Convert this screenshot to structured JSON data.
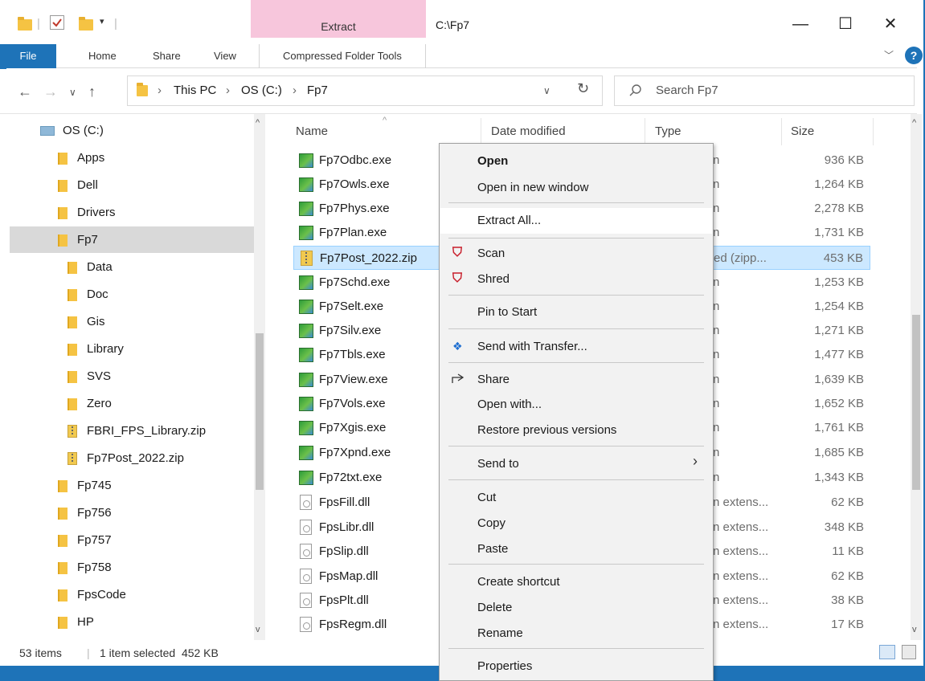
{
  "window": {
    "path": "C:\\Fp7",
    "context_tab": "Extract"
  },
  "titlebar": {
    "minimize": "—",
    "maximize": "☐",
    "close": "✕"
  },
  "ribbon": {
    "file": "File",
    "home": "Home",
    "share": "Share",
    "view": "View",
    "compressed": "Compressed Folder Tools",
    "help": "?"
  },
  "address": {
    "this_pc": "This PC",
    "drive": "OS (C:)",
    "folder": "Fp7"
  },
  "search": {
    "placeholder": "Search Fp7"
  },
  "tree": [
    {
      "label": "OS (C:)",
      "type": "drive"
    },
    {
      "label": "Apps",
      "type": "folder"
    },
    {
      "label": "Dell",
      "type": "folder"
    },
    {
      "label": "Drivers",
      "type": "folder"
    },
    {
      "label": "Fp7",
      "type": "folder",
      "selected": true
    },
    {
      "label": "Data",
      "type": "folder"
    },
    {
      "label": "Doc",
      "type": "folder"
    },
    {
      "label": "Gis",
      "type": "folder"
    },
    {
      "label": "Library",
      "type": "folder"
    },
    {
      "label": "SVS",
      "type": "folder"
    },
    {
      "label": "Zero",
      "type": "folder"
    },
    {
      "label": "FBRI_FPS_Library.zip",
      "type": "zip"
    },
    {
      "label": "Fp7Post_2022.zip",
      "type": "zip"
    },
    {
      "label": "Fp745",
      "type": "folder"
    },
    {
      "label": "Fp756",
      "type": "folder"
    },
    {
      "label": "Fp757",
      "type": "folder"
    },
    {
      "label": "Fp758",
      "type": "folder"
    },
    {
      "label": "FpsCode",
      "type": "folder"
    },
    {
      "label": "HP",
      "type": "folder"
    }
  ],
  "columns": {
    "name": "Name",
    "date": "Date modified",
    "type": "Type",
    "size": "Size"
  },
  "files": [
    {
      "name": "Fp7Odbc.exe",
      "type": "n",
      "size": "936 KB",
      "icon": "exe"
    },
    {
      "name": "Fp7Owls.exe",
      "type": "n",
      "size": "1,264 KB",
      "icon": "exe"
    },
    {
      "name": "Fp7Phys.exe",
      "type": "n",
      "size": "2,278 KB",
      "icon": "exe"
    },
    {
      "name": "Fp7Plan.exe",
      "type": "n",
      "size": "1,731 KB",
      "icon": "exe"
    },
    {
      "name": "Fp7Post_2022.zip",
      "type": "ed (zipp...",
      "size": "453 KB",
      "icon": "zip",
      "selected": true
    },
    {
      "name": "Fp7Schd.exe",
      "type": "n",
      "size": "1,253 KB",
      "icon": "exe"
    },
    {
      "name": "Fp7Selt.exe",
      "type": "n",
      "size": "1,254 KB",
      "icon": "exe"
    },
    {
      "name": "Fp7Silv.exe",
      "type": "n",
      "size": "1,271 KB",
      "icon": "exe"
    },
    {
      "name": "Fp7Tbls.exe",
      "type": "n",
      "size": "1,477 KB",
      "icon": "exe"
    },
    {
      "name": "Fp7View.exe",
      "type": "n",
      "size": "1,639 KB",
      "icon": "exe"
    },
    {
      "name": "Fp7Vols.exe",
      "type": "n",
      "size": "1,652 KB",
      "icon": "exe"
    },
    {
      "name": "Fp7Xgis.exe",
      "type": "n",
      "size": "1,761 KB",
      "icon": "exe"
    },
    {
      "name": "Fp7Xpnd.exe",
      "type": "n",
      "size": "1,685 KB",
      "icon": "exe"
    },
    {
      "name": "Fp72txt.exe",
      "type": "n",
      "size": "1,343 KB",
      "icon": "exe"
    },
    {
      "name": "FpsFill.dll",
      "type": "n extens...",
      "size": "62 KB",
      "icon": "dll"
    },
    {
      "name": "FpsLibr.dll",
      "type": "n extens...",
      "size": "348 KB",
      "icon": "dll"
    },
    {
      "name": "FpSlip.dll",
      "type": "n extens...",
      "size": "11 KB",
      "icon": "dll"
    },
    {
      "name": "FpsMap.dll",
      "type": "n extens...",
      "size": "62 KB",
      "icon": "dll"
    },
    {
      "name": "FpsPlt.dll",
      "type": "n extens...",
      "size": "38 KB",
      "icon": "dll"
    },
    {
      "name": "FpsRegm.dll",
      "type": "n extens...",
      "size": "17 KB",
      "icon": "dll"
    }
  ],
  "context_menu": {
    "open": "Open",
    "open_new_window": "Open in new window",
    "extract_all": "Extract All...",
    "scan": "Scan",
    "shred": "Shred",
    "pin_to_start": "Pin to Start",
    "send_with_transfer": "Send with Transfer...",
    "share": "Share",
    "open_with": "Open with...",
    "restore_previous": "Restore previous versions",
    "send_to": "Send to",
    "cut": "Cut",
    "copy": "Copy",
    "paste": "Paste",
    "create_shortcut": "Create shortcut",
    "delete": "Delete",
    "rename": "Rename",
    "properties": "Properties"
  },
  "status": {
    "items": "53 items",
    "selected": "1 item selected  452 KB"
  },
  "colors": {
    "accent": "#1e73b8",
    "context_tab": "#f7c6dc",
    "selection": "#cce8ff",
    "mcafee": "#c81e2b"
  }
}
